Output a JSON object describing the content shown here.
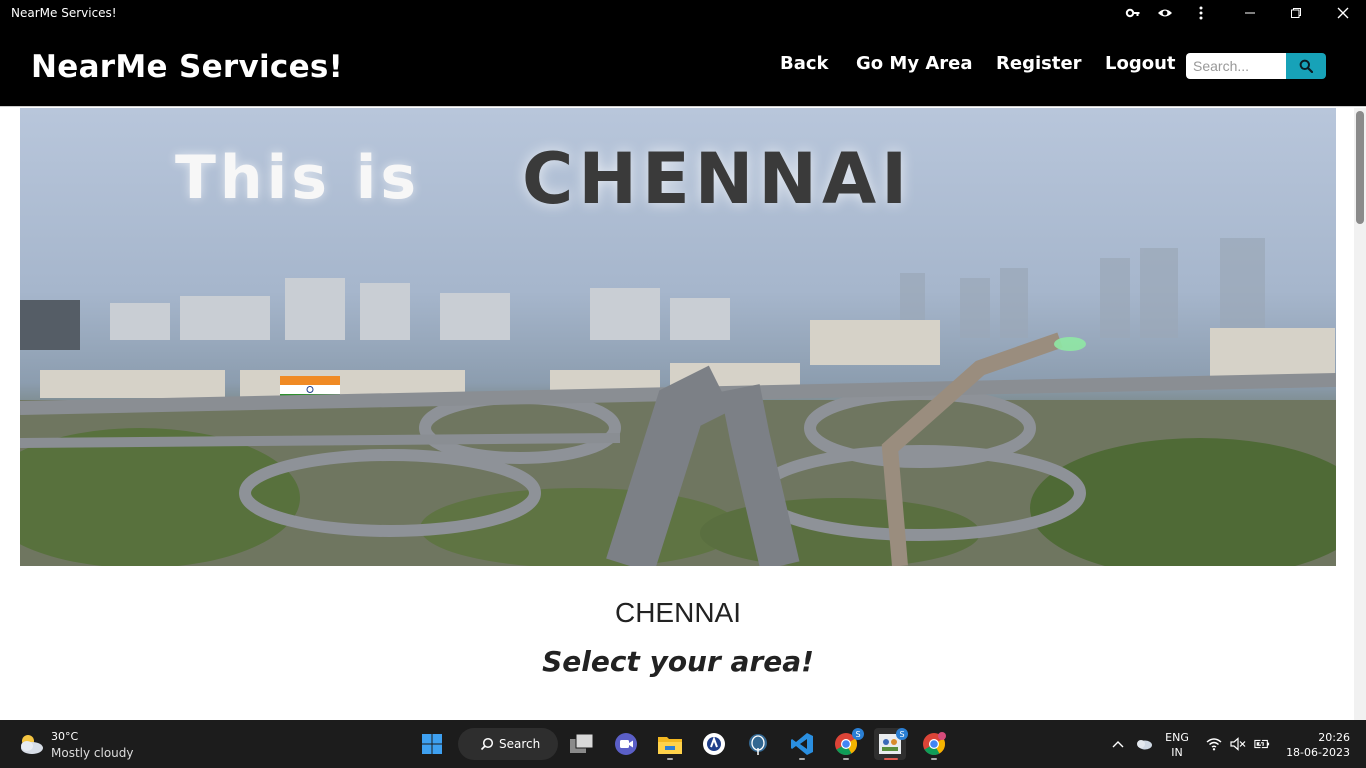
{
  "window": {
    "title": "NearMe Services!"
  },
  "navbar": {
    "brand": "NearMe Services!",
    "links": {
      "back": "Back",
      "my_area": "Go My Area",
      "register": "Register",
      "logout": "Logout"
    },
    "search_placeholder": "Search...",
    "search_icon": "search-icon"
  },
  "hero": {
    "title_part1": "This is",
    "title_part2": "CHENNAI"
  },
  "content": {
    "city": "CHENNAI",
    "subtitle": "Select your area!"
  },
  "taskbar": {
    "weather": {
      "temp": "30°C",
      "desc": "Mostly cloudy"
    },
    "search_label": "Search",
    "lang_line1": "ENG",
    "lang_line2": "IN",
    "time": "20:26",
    "date": "18-06-2023",
    "apps": [
      "start",
      "search",
      "task-view",
      "teams-meet",
      "file-explorer",
      "azure-data-studio",
      "postgresql",
      "vscode",
      "chrome",
      "nearme-app",
      "chrome-profile"
    ],
    "badges": {
      "chrome": "S",
      "nearme": "S"
    }
  },
  "colors": {
    "navbar_bg": "#000000",
    "search_button": "#17a2b8",
    "taskbar_bg": "#1c1c1c"
  }
}
